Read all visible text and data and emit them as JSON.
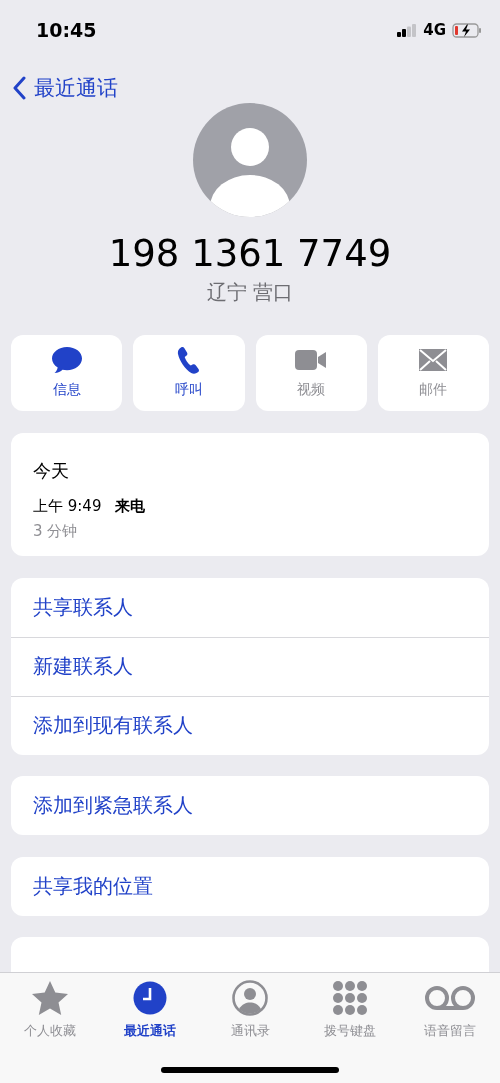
{
  "status_bar": {
    "time": "10:45",
    "network": "4G"
  },
  "nav": {
    "back_label": "最近通话"
  },
  "contact": {
    "number": "198 1361 7749",
    "location": "辽宁 营口"
  },
  "actions": [
    {
      "kind": "message",
      "label": "信息",
      "disabled": false
    },
    {
      "kind": "call",
      "label": "呼叫",
      "disabled": false
    },
    {
      "kind": "video",
      "label": "视频",
      "disabled": true
    },
    {
      "kind": "mail",
      "label": "邮件",
      "disabled": true
    }
  ],
  "call_history": {
    "day": "今天",
    "entries": [
      {
        "time": "上午 9:49",
        "type": "来电",
        "duration": "3 分钟"
      }
    ]
  },
  "option_groups": [
    {
      "items": [
        {
          "label": "共享联系人"
        },
        {
          "label": "新建联系人"
        },
        {
          "label": "添加到现有联系人"
        }
      ]
    },
    {
      "items": [
        {
          "label": "添加到紧急联系人"
        }
      ]
    },
    {
      "items": [
        {
          "label": "共享我的位置"
        }
      ]
    }
  ],
  "tab_bar": [
    {
      "kind": "favorites",
      "label": "个人收藏",
      "selected": false
    },
    {
      "kind": "recents",
      "label": "最近通话",
      "selected": true
    },
    {
      "kind": "contacts",
      "label": "通讯录",
      "selected": false
    },
    {
      "kind": "keypad",
      "label": "拨号键盘",
      "selected": false
    },
    {
      "kind": "voicemail",
      "label": "语音留言",
      "selected": false
    }
  ]
}
